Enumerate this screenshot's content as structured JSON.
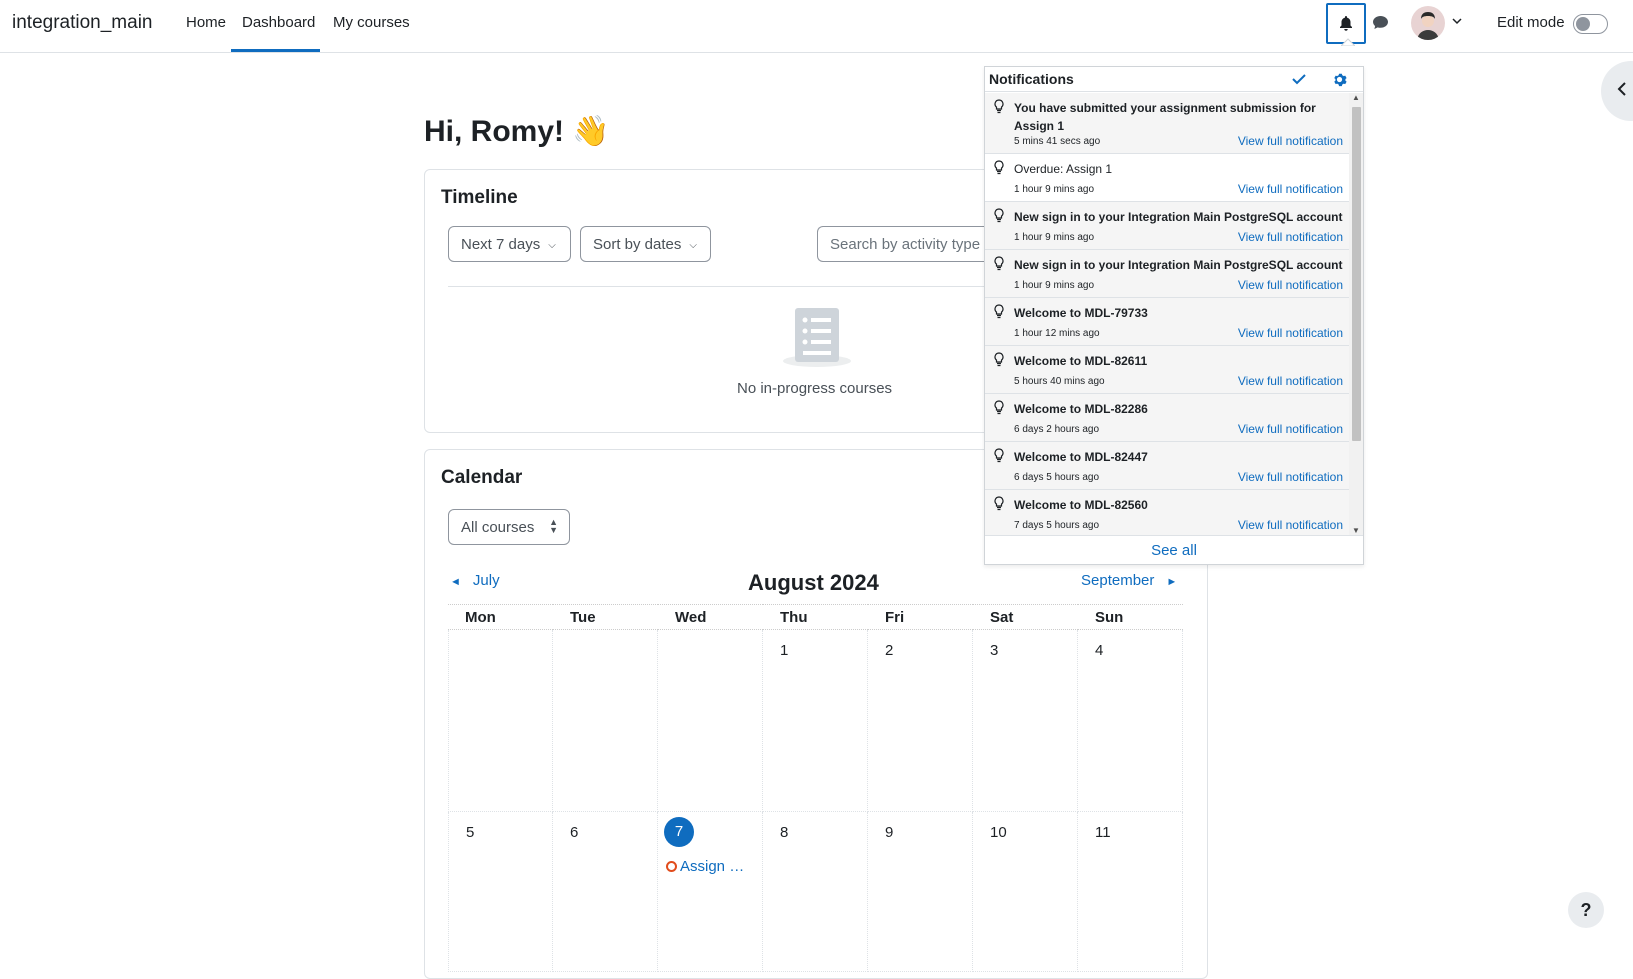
{
  "navbar": {
    "brand": "integration_main",
    "links": [
      "Home",
      "Dashboard",
      "My courses"
    ],
    "active_link": "Dashboard",
    "edit_mode_label": "Edit mode"
  },
  "greeting": "Hi, Romy! 👋",
  "timeline": {
    "title": "Timeline",
    "filter_days": "Next 7 days",
    "sort": "Sort by dates",
    "search_placeholder": "Search by activity type",
    "empty_text": "No in-progress courses"
  },
  "calendar": {
    "title": "Calendar",
    "course_filter": "All courses",
    "prev_month": "July",
    "next_month": "September",
    "month": "August 2024",
    "weekdays": [
      "Mon",
      "Tue",
      "Wed",
      "Thu",
      "Fri",
      "Sat",
      "Sun"
    ],
    "week1": [
      "",
      "",
      "",
      "1",
      "2",
      "3",
      "4"
    ],
    "week2": [
      "5",
      "6",
      "7",
      "8",
      "9",
      "10",
      "11"
    ],
    "today": "7",
    "event_label": "Assign …",
    "event_color": "#e14c1c"
  },
  "notifications": {
    "title": "Notifications",
    "see_all": "See all",
    "view_label": "View full notification",
    "items": [
      {
        "message": "You have submitted your assignment submission for Assign 1",
        "time": "5 mins 41 secs ago",
        "bold": true
      },
      {
        "message": "Overdue: Assign 1",
        "time": "1 hour 9 mins ago",
        "bold": false
      },
      {
        "message": "New sign in to your Integration Main PostgreSQL account",
        "time": "1 hour 9 mins ago",
        "bold": true
      },
      {
        "message": "New sign in to your Integration Main PostgreSQL account",
        "time": "1 hour 9 mins ago",
        "bold": true
      },
      {
        "message": "Welcome to MDL-79733",
        "time": "1 hour 12 mins ago",
        "bold": true
      },
      {
        "message": "Welcome to MDL-82611",
        "time": "5 hours 40 mins ago",
        "bold": true
      },
      {
        "message": "Welcome to MDL-82286",
        "time": "6 days 2 hours ago",
        "bold": true
      },
      {
        "message": "Welcome to MDL-82447",
        "time": "6 days 5 hours ago",
        "bold": true
      },
      {
        "message": "Welcome to MDL-82560",
        "time": "7 days 5 hours ago",
        "bold": true
      }
    ]
  },
  "help_label": "?",
  "colors": {
    "accent": "#0f6cbf",
    "event": "#e14c1c"
  }
}
